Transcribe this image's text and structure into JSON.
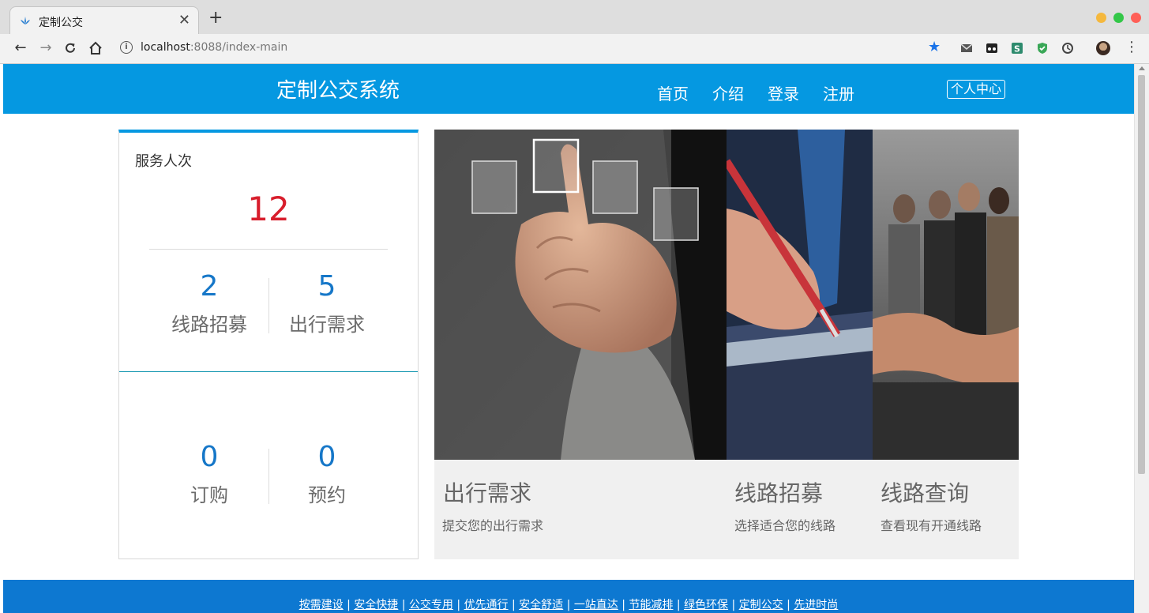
{
  "browser": {
    "tab_title": "定制公交",
    "tab_close": "✕",
    "new_tab": "+",
    "url_host": "localhost",
    "url_rest": ":8088/index-main",
    "info": "i"
  },
  "header": {
    "title": "定制公交系统",
    "nav": [
      "首页",
      "介绍",
      "登录",
      "注册"
    ],
    "personal_center": "个人中心"
  },
  "stats": {
    "label": "服务人次",
    "total": "12",
    "items": [
      {
        "value": "2",
        "label": "线路招募"
      },
      {
        "value": "5",
        "label": "出行需求"
      },
      {
        "value": "0",
        "label": "订购"
      },
      {
        "value": "0",
        "label": "预约"
      }
    ]
  },
  "tiles": [
    {
      "title": "出行需求",
      "subtitle": "提交您的出行需求",
      "image": "touchscreen-hand-photo"
    },
    {
      "title": "线路招募",
      "subtitle": "选择适合您的线路",
      "image": "signing-pen-photo"
    },
    {
      "title": "线路查询",
      "subtitle": "查看现有开通线路",
      "image": "handshake-team-photo"
    }
  ],
  "footer": {
    "links": [
      "按需建设",
      "安全快捷",
      "公交专用",
      "优先通行",
      "安全舒适",
      "一站直达",
      "节能减排",
      "绿色环保",
      "定制公交",
      "先进时尚"
    ],
    "separator": " | "
  },
  "colors": {
    "header_bg": "#0598e1",
    "footer_bg": "#0d78d1",
    "total_red": "#d81e2c",
    "stat_blue": "#1677c8"
  }
}
